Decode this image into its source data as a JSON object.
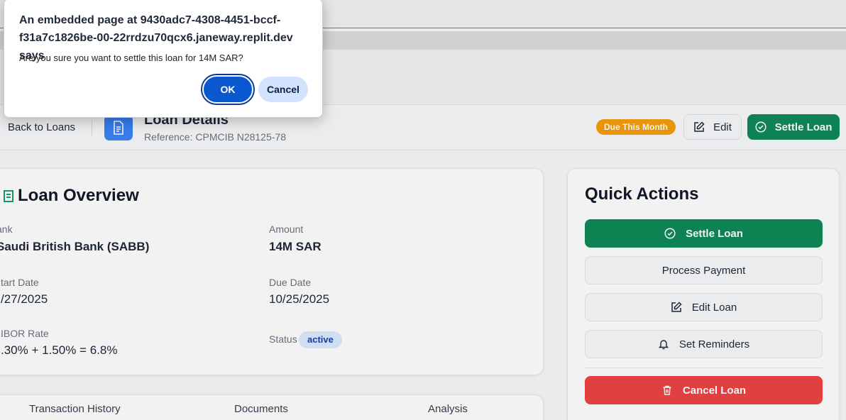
{
  "dialog": {
    "title": "An embedded page at 9430adc7-4308-4451-bccf-f31a7c1826be-00-22rrdzu70qcx6.janeway.replit.dev says",
    "message": "Are you sure you want to settle this loan for 14M SAR?",
    "ok_label": "OK",
    "cancel_label": "Cancel"
  },
  "header": {
    "back_label": "Back to Loans",
    "title": "Loan Details",
    "reference": "Reference: CPMCIB N28125-78",
    "due_badge": "Due This Month",
    "edit_label": "Edit",
    "settle_label": "Settle Loan"
  },
  "overview": {
    "title": "Loan Overview",
    "bank_label": "ank",
    "bank_value": "Saudi British Bank (SABB)",
    "amount_label": "Amount",
    "amount_value": "14M SAR",
    "start_label": "tart Date",
    "start_value": "/27/2025",
    "due_label": "Due Date",
    "due_value": "10/25/2025",
    "rate_label": "IBOR Rate",
    "rate_value": ".30% + 1.50% = 6.8%",
    "status_label": "Status",
    "status_value": "active"
  },
  "quick_actions": {
    "title": "Quick Actions",
    "settle_label": "Settle Loan",
    "process_label": "Process Payment",
    "edit_label": "Edit Loan",
    "reminders_label": "Set Reminders",
    "cancel_label": "Cancel Loan"
  },
  "tabs": {
    "history": "Transaction History",
    "documents": "Documents",
    "analysis": "Analysis"
  },
  "colors": {
    "primary_green": "#0f8a58",
    "danger_red": "#ef4444",
    "warning_amber": "#f59e0b",
    "dialog_ok_blue": "#0b57d0",
    "status_blue": "#dbeafe"
  }
}
